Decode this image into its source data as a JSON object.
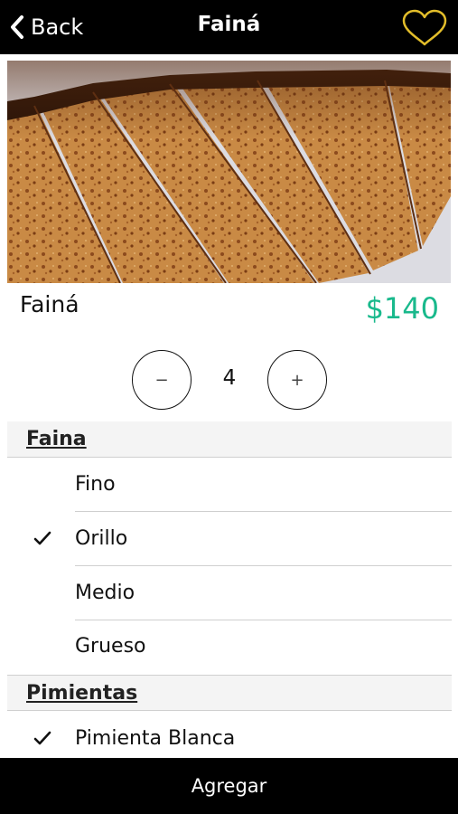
{
  "header": {
    "back_label": "Back",
    "title": "Fainá"
  },
  "product": {
    "name": "Fainá",
    "price": "$140",
    "price_color": "#19b98c"
  },
  "stepper": {
    "minus": "−",
    "quantity": "4",
    "plus": "+"
  },
  "sections": [
    {
      "title": "Faina",
      "options": [
        {
          "label": "Fino",
          "selected": false
        },
        {
          "label": "Orillo",
          "selected": true
        },
        {
          "label": "Medio",
          "selected": false
        },
        {
          "label": "Grueso",
          "selected": false
        }
      ]
    },
    {
      "title": "Pimientas",
      "options": [
        {
          "label": "Pimienta Blanca",
          "selected": true
        }
      ]
    }
  ],
  "footer": {
    "add_label": "Agregar"
  },
  "icons": {
    "back": "chevron-left-icon",
    "favorite": "heart-outline-icon",
    "check": "checkmark-icon"
  },
  "colors": {
    "bar": "#000000",
    "heart": "#e2bd2a",
    "accent": "#19b98c"
  }
}
